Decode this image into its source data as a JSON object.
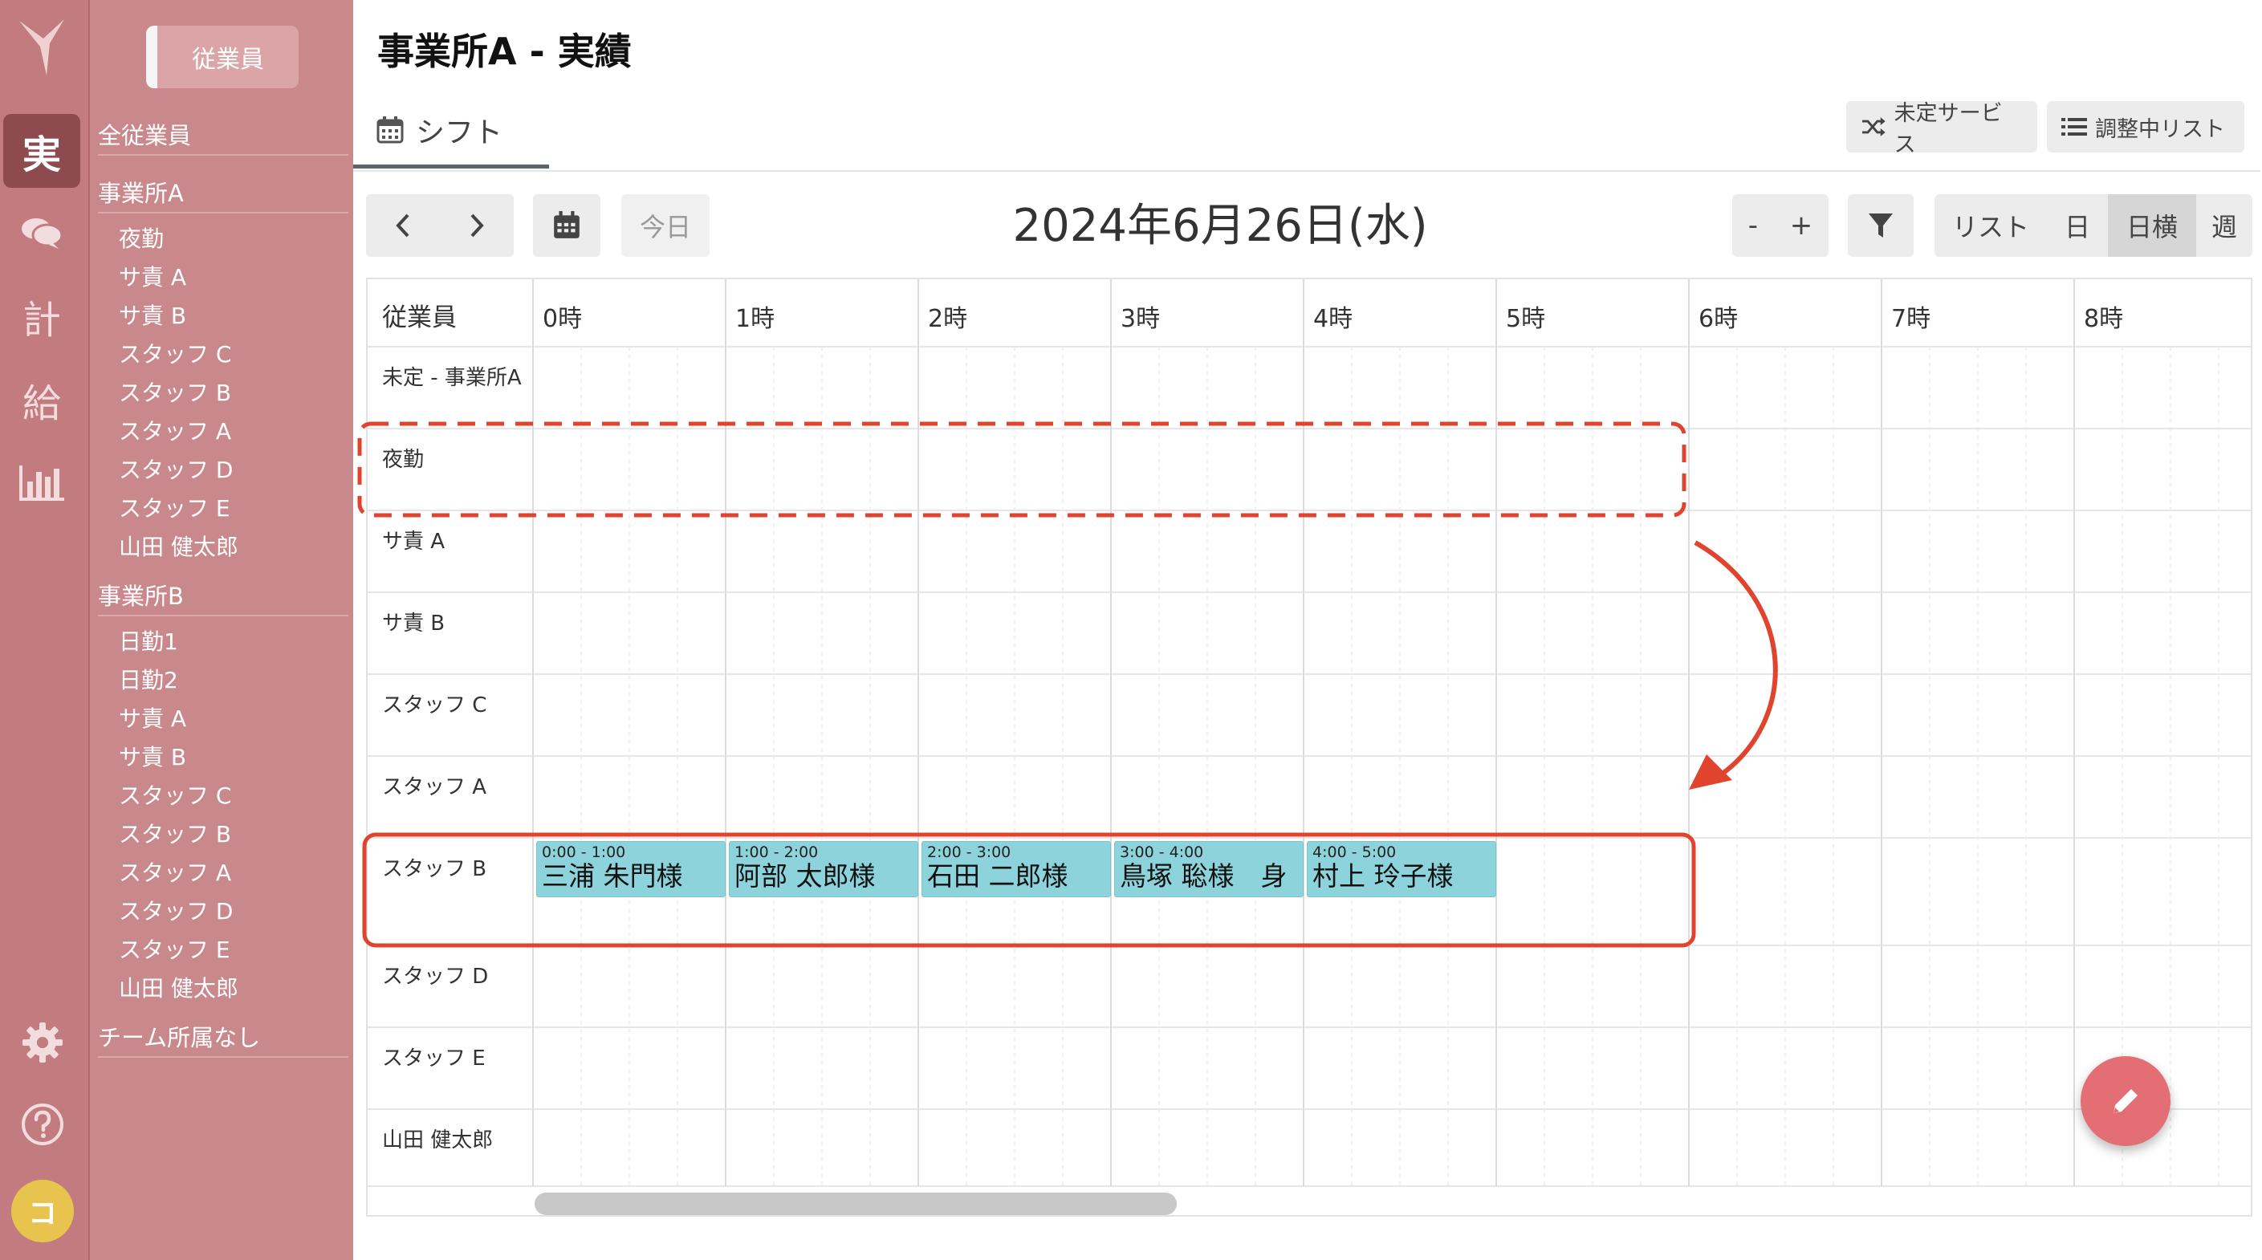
{
  "rail": {
    "items": [
      {
        "label": "実",
        "active": true
      },
      {
        "label": "chat-icon"
      },
      {
        "label": "計"
      },
      {
        "label": "給"
      },
      {
        "label": "chart-icon"
      }
    ],
    "avatar": "コ"
  },
  "sidebar": {
    "tab": "従業員",
    "groups": [
      {
        "name": "全従業員",
        "items": []
      },
      {
        "name": "事業所A",
        "items": [
          "夜勤",
          "サ責 A",
          "サ責 B",
          "スタッフ C",
          "スタッフ B",
          "スタッフ A",
          "スタッフ D",
          "スタッフ E",
          "山田 健太郎"
        ]
      },
      {
        "name": "事業所B",
        "items": [
          "日勤1",
          "日勤2",
          "サ責 A",
          "サ責 B",
          "スタッフ C",
          "スタッフ B",
          "スタッフ A",
          "スタッフ D",
          "スタッフ E",
          "山田 健太郎"
        ]
      },
      {
        "name": "チーム所属なし",
        "items": []
      }
    ]
  },
  "header": {
    "title": "事業所A  - 実績",
    "tab": "シフト",
    "unassigned_services": "未定サービス",
    "adjusting_list": "調整中リスト"
  },
  "toolbar": {
    "today": "今日",
    "date": "2024年6月26日(水)",
    "zoom_out": "-",
    "zoom_in": "+",
    "views": [
      "リスト",
      "日",
      "日横",
      "週"
    ],
    "active_view": "日横"
  },
  "grid": {
    "employee_header": "従業員",
    "hours": [
      "0時",
      "1時",
      "2時",
      "3時",
      "4時",
      "5時",
      "6時",
      "7時",
      "8時"
    ],
    "rows": [
      "未定 - 事業所A",
      "夜勤",
      "サ責 A",
      "サ責 B",
      "スタッフ C",
      "スタッフ A",
      "スタッフ B",
      "スタッフ D",
      "スタッフ E",
      "山田 健太郎"
    ],
    "shifts": [
      {
        "row": "スタッフ B",
        "time": "0:00 - 1:00",
        "name": "三浦 朱門様",
        "start": 0,
        "end": 1
      },
      {
        "row": "スタッフ B",
        "time": "1:00 - 2:00",
        "name": "阿部 太郎様",
        "start": 1,
        "end": 2
      },
      {
        "row": "スタッフ B",
        "time": "2:00 - 3:00",
        "name": "石田 二郎様",
        "start": 2,
        "end": 3
      },
      {
        "row": "スタッフ B",
        "time": "3:00 - 4:00",
        "name": "鳥塚 聡様　身",
        "start": 3,
        "end": 4
      },
      {
        "row": "スタッフ B",
        "time": "4:00 - 5:00",
        "name": "村上 玲子様",
        "start": 4,
        "end": 5
      }
    ]
  },
  "colors": {
    "rail": "#c27b7f",
    "sidebar": "#c9898c",
    "shift": "#8dd3dc",
    "annotation": "#e0442e",
    "fab": "#e36e73"
  }
}
